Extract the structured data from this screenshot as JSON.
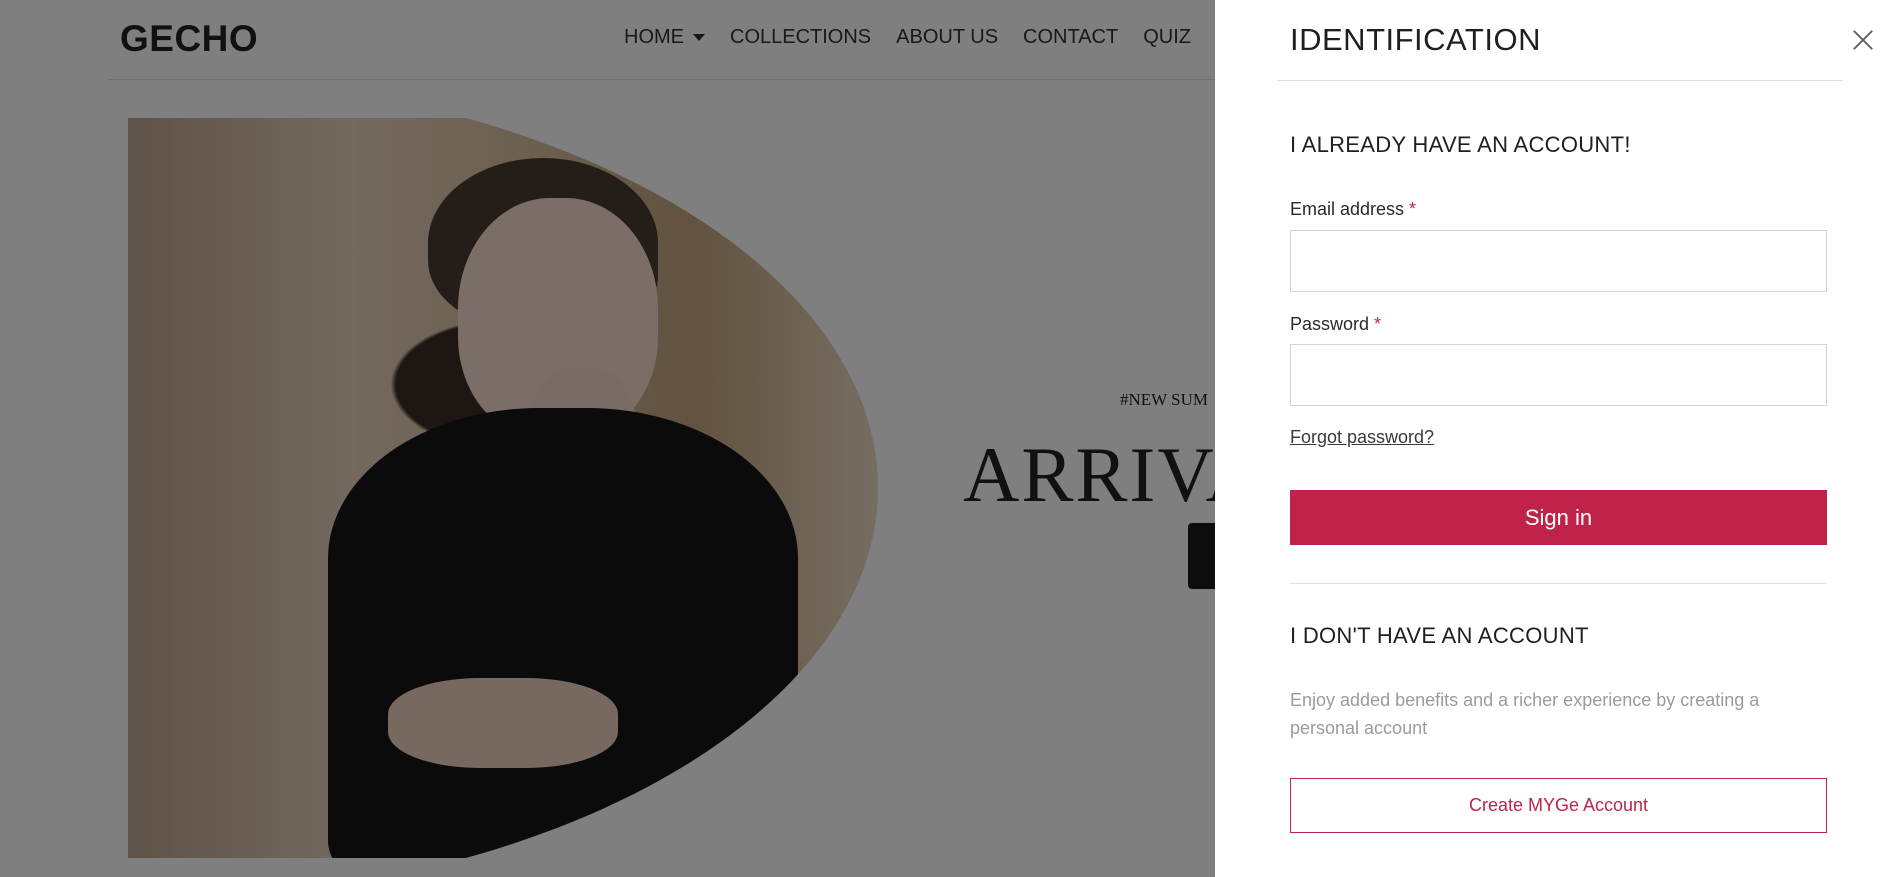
{
  "site": {
    "logo": "GECHO",
    "nav": [
      {
        "label": "HOME",
        "has_dropdown": true
      },
      {
        "label": "COLLECTIONS"
      },
      {
        "label": "ABOUT US"
      },
      {
        "label": "CONTACT"
      },
      {
        "label": "QUIZ"
      }
    ],
    "hero": {
      "tag": "#NEW SUM",
      "title": "ARRIVA"
    }
  },
  "panel": {
    "title": "IDENTIFICATION",
    "login": {
      "heading": "I ALREADY HAVE AN ACCOUNT!",
      "email_label": "Email address",
      "password_label": "Password",
      "required_mark": "*",
      "email_value": "",
      "password_value": "",
      "forgot_link": "Forgot password?",
      "signin_label": "Sign in"
    },
    "register": {
      "heading": "I DON'T HAVE AN ACCOUNT",
      "description": "Enjoy added benefits and a richer experience by creating a personal account",
      "create_label": "Create MYGe Account"
    }
  },
  "colors": {
    "accent": "#bf2349",
    "overlay": "rgba(0,0,0,0.5)"
  }
}
